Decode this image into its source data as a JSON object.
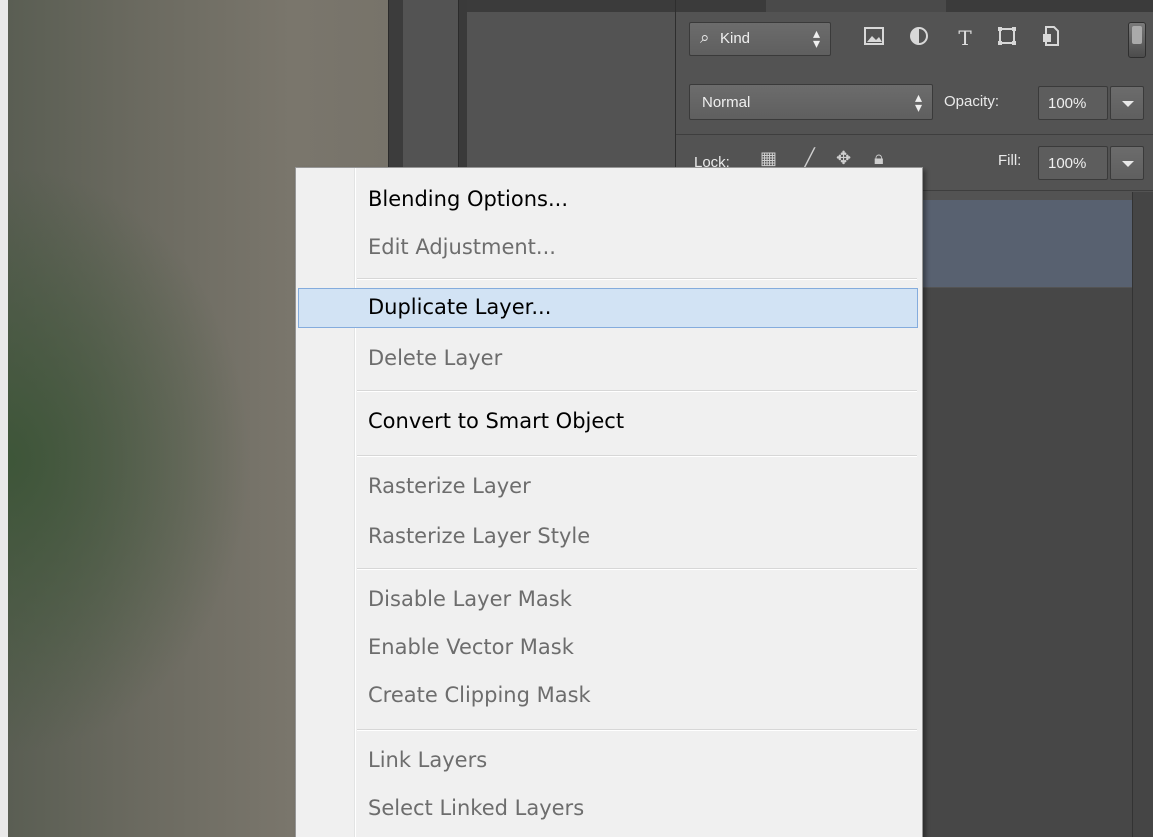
{
  "layers_panel": {
    "kind_filter": {
      "icon": "search-icon",
      "label": "Kind"
    },
    "filter_icons": [
      "image-filter-icon",
      "adjustment-filter-icon",
      "type-filter-icon",
      "shape-filter-icon",
      "smart-object-filter-icon"
    ],
    "blend_mode": "Normal",
    "opacity_label": "Opacity:",
    "opacity_value": "100%",
    "lock_label": "Lock:",
    "fill_label": "Fill:",
    "fill_value": "100%"
  },
  "context_menu": {
    "items": [
      {
        "label": "Blending Options...",
        "enabled": true
      },
      {
        "label": "Edit Adjustment...",
        "enabled": false
      },
      {
        "label": "Duplicate Layer...",
        "enabled": true,
        "highlighted": true
      },
      {
        "label": "Delete Layer",
        "enabled": false
      },
      {
        "label": "Convert to Smart Object",
        "enabled": true
      },
      {
        "label": "Rasterize Layer",
        "enabled": false
      },
      {
        "label": "Rasterize Layer Style",
        "enabled": false
      },
      {
        "label": "Disable Layer Mask",
        "enabled": false
      },
      {
        "label": "Enable Vector Mask",
        "enabled": false
      },
      {
        "label": "Create Clipping Mask",
        "enabled": false
      },
      {
        "label": "Link Layers",
        "enabled": false
      },
      {
        "label": "Select Linked Layers",
        "enabled": false
      }
    ]
  },
  "colors": {
    "menu_highlight": "#d2e3f4",
    "menu_highlight_border": "#84acdd",
    "selected_layer": "#586170",
    "panel_bg": "#535353"
  }
}
